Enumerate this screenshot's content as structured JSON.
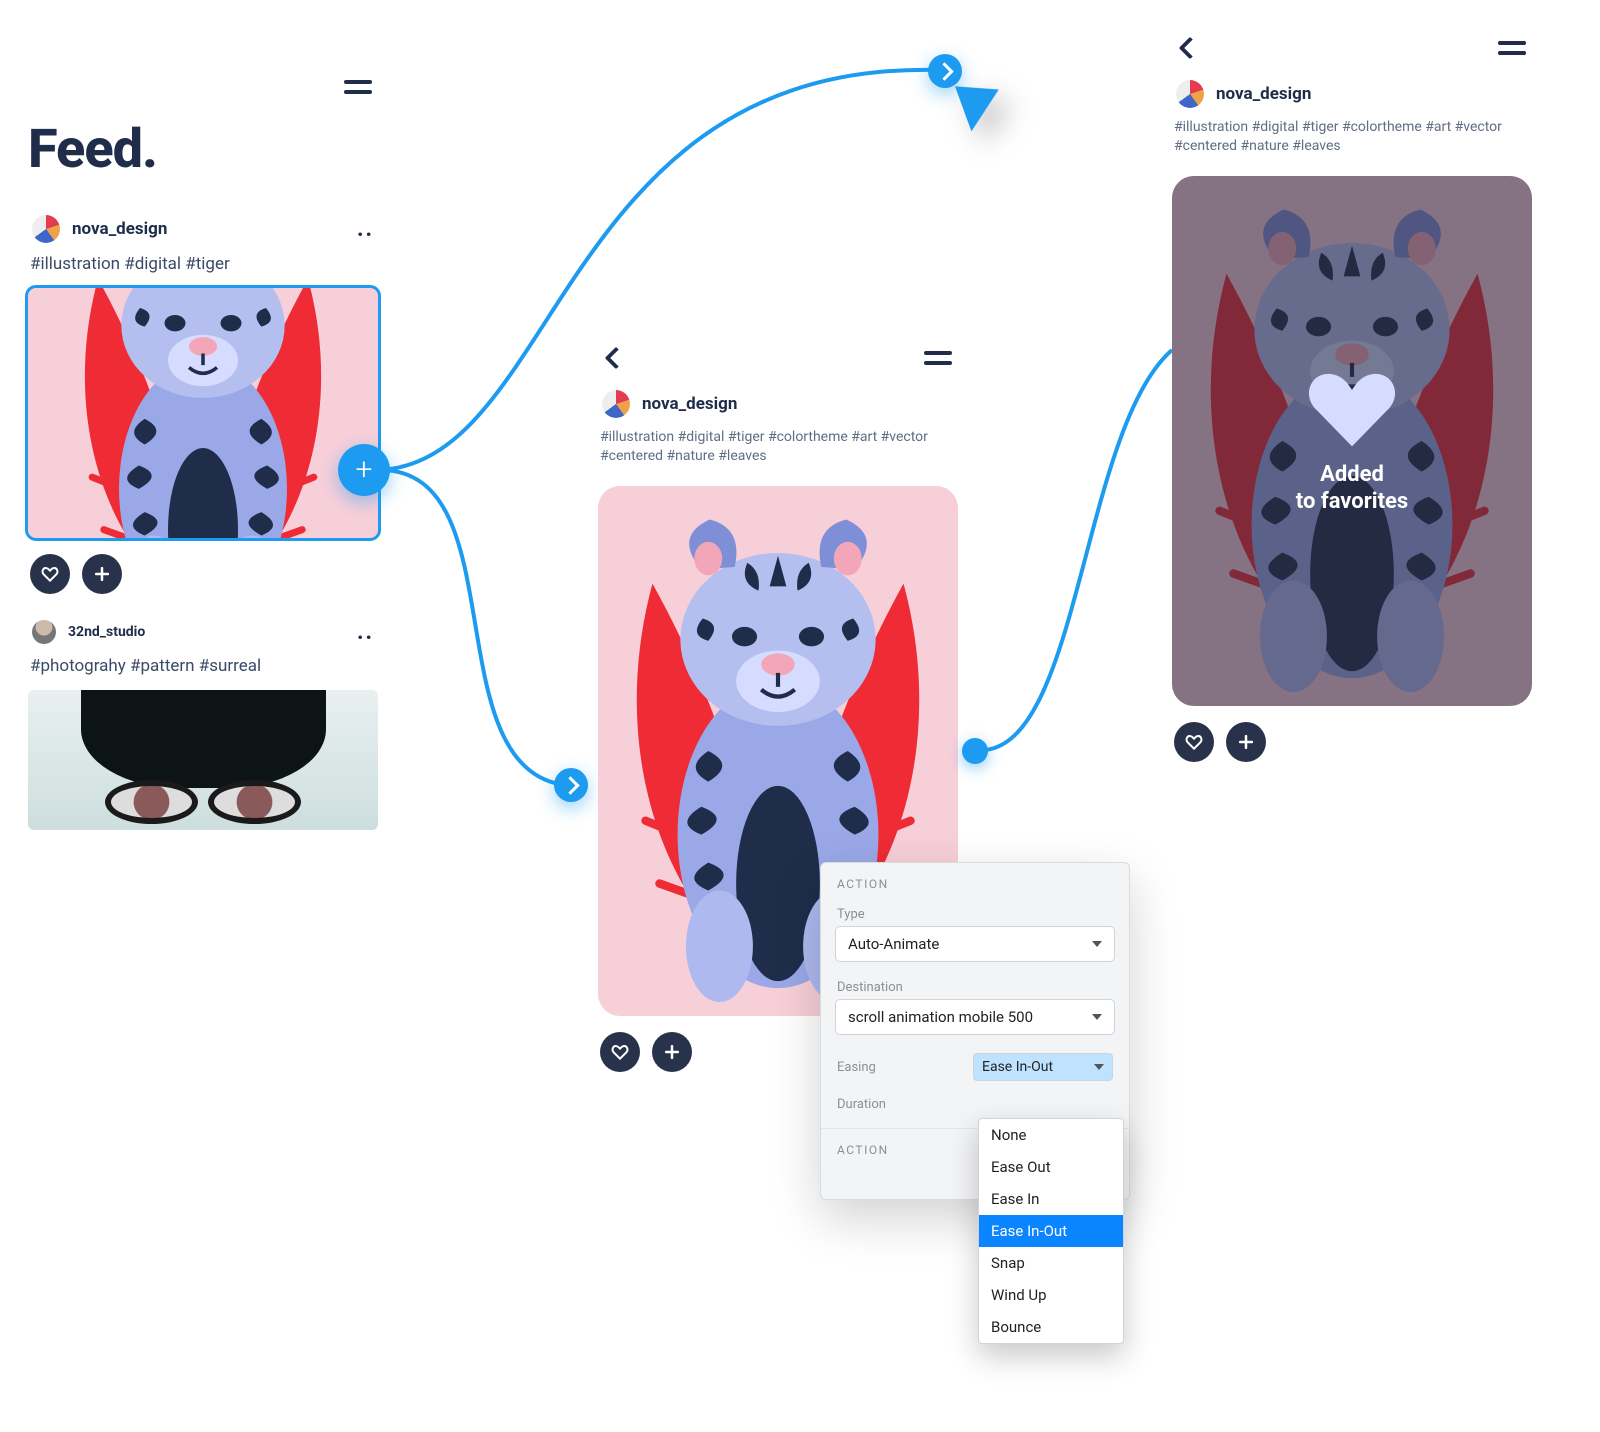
{
  "colors": {
    "accent": "#1d9bf0",
    "ink": "#1f2d4a"
  },
  "screen_feed": {
    "title": "Feed.",
    "posts": [
      {
        "username": "nova_design",
        "hashtags": "#illustration #digital #tiger",
        "selected": true
      },
      {
        "username": "32nd_studio",
        "hashtags": "#photograhy #pattern #surreal",
        "selected": false
      }
    ]
  },
  "screen_detail": {
    "username": "nova_design",
    "hashtags": "#illustration #digital #tiger #colortheme #art #vector #centered #nature #leaves"
  },
  "screen_favorited": {
    "username": "nova_design",
    "hashtags": "#illustration #digital #tiger #colortheme #art #vector #centered #nature #leaves",
    "overlay_line1": "Added",
    "overlay_line2": "to favorites"
  },
  "action_panel": {
    "section_label": "ACTION",
    "type_label": "Type",
    "type_value": "Auto-Animate",
    "destination_label": "Destination",
    "destination_value": "scroll animation mobile 500",
    "easing_label": "Easing",
    "easing_value": "Ease In-Out",
    "duration_label": "Duration",
    "second_section_label": "ACTION",
    "easing_options": [
      "None",
      "Ease Out",
      "Ease In",
      "Ease In-Out",
      "Snap",
      "Wind Up",
      "Bounce"
    ],
    "easing_selected_index": 3
  }
}
